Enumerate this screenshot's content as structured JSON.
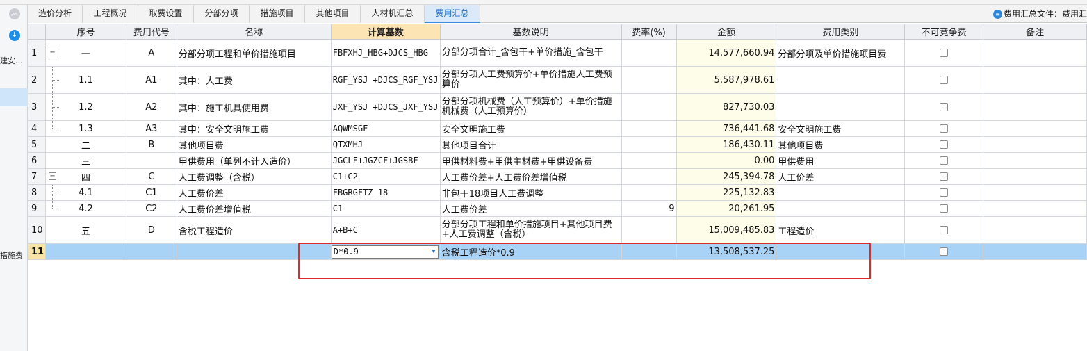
{
  "left_panel": {
    "label_top": "建安...",
    "label_bottom": "措施费"
  },
  "tabs": [
    {
      "label": "造价分析",
      "active": false
    },
    {
      "label": "工程概况",
      "active": false
    },
    {
      "label": "取费设置",
      "active": false
    },
    {
      "label": "分部分项",
      "active": false
    },
    {
      "label": "措施项目",
      "active": false
    },
    {
      "label": "其他项目",
      "active": false
    },
    {
      "label": "人材机汇总",
      "active": false
    },
    {
      "label": "费用汇总",
      "active": true
    }
  ],
  "file_label": "费用汇总文件：费用汇",
  "columns": {
    "seq": "序号",
    "code": "费用代号",
    "name": "名称",
    "base": "计算基数",
    "desc": "基数说明",
    "rate": "费率(%)",
    "amount": "金额",
    "category": "费用类别",
    "noncomp": "不可竞争费",
    "remark": "备注"
  },
  "rows": [
    {
      "idx": "1",
      "seq": "一",
      "code": "A",
      "name": "分部分项工程和单价措施项目",
      "base": "FBFXHJ_HBG+DJCS_HBG",
      "desc": "分部分项合计_含包干+单价措施_含包干",
      "rate": "",
      "amount": "14,577,660.94",
      "category": "分部分项及单价措施项目费"
    },
    {
      "idx": "2",
      "seq": "1.1",
      "code": "A1",
      "name": "其中：人工费",
      "base": "RGF_YSJ +DJCS_RGF_YSJ",
      "desc": "分部分项人工费预算价+单价措施人工费预算价",
      "rate": "",
      "amount": "5,587,978.61",
      "category": ""
    },
    {
      "idx": "3",
      "seq": "1.2",
      "code": "A2",
      "name": "其中：施工机具使用费",
      "base": "JXF_YSJ +DJCS_JXF_YSJ",
      "desc": "分部分项机械费（人工预算价）+单价措施机械费（人工预算价）",
      "rate": "",
      "amount": "827,730.03",
      "category": ""
    },
    {
      "idx": "4",
      "seq": "1.3",
      "code": "A3",
      "name": "其中：安全文明施工费",
      "base": "AQWMSGF",
      "desc": "安全文明施工费",
      "rate": "",
      "amount": "736,441.68",
      "category": "安全文明施工费"
    },
    {
      "idx": "5",
      "seq": "二",
      "code": "B",
      "name": "其他项目费",
      "base": "QTXMHJ",
      "desc": "其他项目合计",
      "rate": "",
      "amount": "186,430.11",
      "category": "其他项目费"
    },
    {
      "idx": "6",
      "seq": "三",
      "code": "",
      "name": "甲供费用（单列不计入造价）",
      "base": "JGCLF+JGZCF+JGSBF",
      "desc": "甲供材料费+甲供主材费+甲供设备费",
      "rate": "",
      "amount": "0.00",
      "category": "甲供费用"
    },
    {
      "idx": "7",
      "seq": "四",
      "code": "C",
      "name": "人工费调整（含税）",
      "base": "C1+C2",
      "desc": "人工费价差+人工费价差增值税",
      "rate": "",
      "amount": "245,394.78",
      "category": "人工价差"
    },
    {
      "idx": "8",
      "seq": "4.1",
      "code": "C1",
      "name": "人工费价差",
      "base": "FBGRGFTZ_18",
      "desc": "非包干18项目人工费调整",
      "rate": "",
      "amount": "225,132.83",
      "category": ""
    },
    {
      "idx": "9",
      "seq": "4.2",
      "code": "C2",
      "name": "人工费价差增值税",
      "base": "C1",
      "desc": "人工费价差",
      "rate": "9",
      "amount": "20,261.95",
      "category": ""
    },
    {
      "idx": "10",
      "seq": "五",
      "code": "D",
      "name": "含税工程造价",
      "base": "A+B+C",
      "desc": "分部分项工程和单价措施项目+其他项目费+人工费调整（含税）",
      "rate": "",
      "amount": "15,009,485.83",
      "category": "工程造价"
    },
    {
      "idx": "11",
      "seq": "",
      "code": "",
      "name": "",
      "base": "D*0.9",
      "desc": "含税工程造价*0.9",
      "rate": "",
      "amount": "13,508,537.25",
      "category": ""
    }
  ]
}
